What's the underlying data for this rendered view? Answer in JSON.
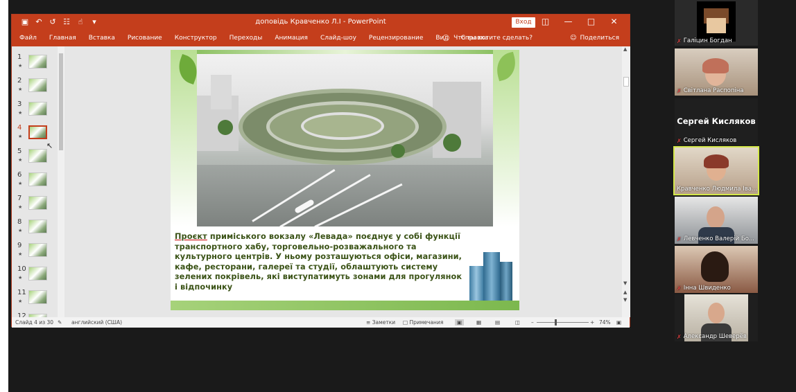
{
  "ppt": {
    "window_title": "доповідь Кравченко Л.І  -  PowerPoint",
    "signin_label": "Вход",
    "ribbon_tabs": [
      "Файл",
      "Главная",
      "Вставка",
      "Рисование",
      "Конструктор",
      "Переходы",
      "Анимация",
      "Слайд-шоу",
      "Рецензирование",
      "Вид",
      "Справка"
    ],
    "tellme_label": "Что вы хотите сделать?",
    "share_label": "Поделиться",
    "thumbnails": [
      "1",
      "2",
      "3",
      "4",
      "5",
      "6",
      "7",
      "8",
      "9",
      "10",
      "11",
      "12"
    ],
    "active_slide": 4,
    "slide_caption_underlined": "Проєкт",
    "slide_caption": " приміського вокзалу «Левада» поєднує у собі функції транспортного хабу, торговельно-розважального та культурного центрів.  У ньому розташуються офіси, магазини, кафе, ресторани, галереї та студії, облаштують систему зелених покрівель, які виступатимуть зонами для прогулянок і відпочинку",
    "status": {
      "slide_count": "Слайд 4 из 30",
      "language": "английский (США)",
      "notes": "Заметки",
      "comments": "Примечания",
      "zoom": "74%"
    },
    "icons": {
      "save": "save-icon",
      "undo": "undo-icon",
      "redo": "redo-icon",
      "lightbulb": "lightbulb-icon",
      "person": "person-icon"
    }
  },
  "participants": [
    {
      "name": "Галіцин Богдан",
      "muted": true
    },
    {
      "name": "Світлана Распопіна",
      "muted": true
    },
    {
      "name": "Сергей Кисляков",
      "muted": true,
      "display_name": "Сергей Кисляков"
    },
    {
      "name": "Кравченко Людмила Іва...",
      "muted": false,
      "active_speaker": true
    },
    {
      "name": "Левченко Валерій Бо...",
      "muted": true
    },
    {
      "name": "Інна Швиденко",
      "muted": true
    },
    {
      "name": "Александр Шеверёв",
      "muted": true
    }
  ],
  "colors": {
    "ppt_accent": "#c43e1c",
    "active_speaker_border": "#d4e84a",
    "slide_text": "#3a5216"
  }
}
